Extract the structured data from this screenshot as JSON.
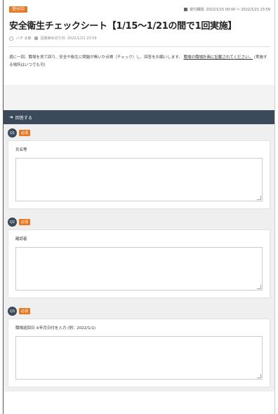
{
  "header": {
    "status": "受付中",
    "period": "受付期間: 2022/1/15 00:00 〜 2022/1/21 23:59",
    "title": "安全衛生チェックシート【1/15〜1/21の間で1回実施】",
    "author": "ハチ 太郎",
    "deadline": "回答締め切り日: 2022/1/21 23:59"
  },
  "description": {
    "text_main": "週に一回、職場を見て回り、安全や衛生に問題が無いか点検（チェック）し、回答をお願いします。",
    "text_link": "職場の職場計画に記載されてください。",
    "text_tail": "(実施する場所はいつでも可)"
  },
  "answer_bar": {
    "label": "回答する"
  },
  "questions": [
    {
      "number": "Q1",
      "required": "必須",
      "label": "氏名等",
      "value": ""
    },
    {
      "number": "Q2",
      "required": "必須",
      "label": "確認者",
      "value": ""
    },
    {
      "number": "Q3",
      "required": "必須",
      "label": "職場巡回日 ※年月日付を入力 (例：2022/1/1)",
      "value": ""
    }
  ],
  "colors": {
    "accent": "#e87722",
    "bar": "#3b4a5a"
  }
}
